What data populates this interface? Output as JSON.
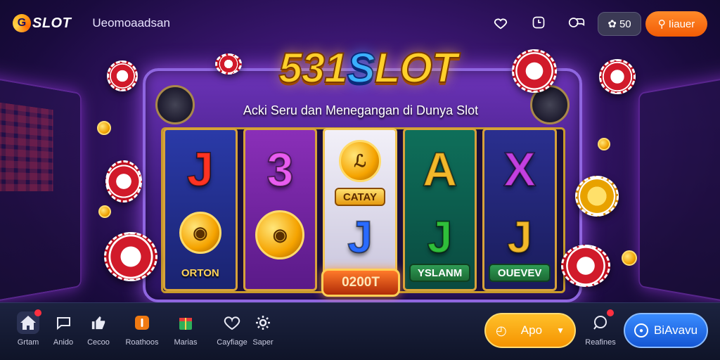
{
  "header": {
    "logo_text": "SLOT",
    "logo_mark": "G",
    "site_name": "Ueomoaadsan",
    "icons": [
      "heart-icon",
      "clock-icon",
      "chat-icon"
    ],
    "coin_value": "50",
    "search_label": "Iiauer"
  },
  "hero": {
    "title_part1": "531",
    "title_part2": "S",
    "title_part3": "LOT",
    "subtitle": "Acki Seru dan Menegangan di Dunya Slot"
  },
  "reels": [
    {
      "symbol": "J",
      "color": "#ff3322",
      "label": "ORTON"
    },
    {
      "symbol": "3",
      "color": "#e85cf0",
      "label": ""
    },
    {
      "symbol": "J",
      "color": "#2a6bff",
      "label": "CATAY"
    },
    {
      "symbol": "A",
      "color": "#f2b82a",
      "label": "YSLANM"
    },
    {
      "symbol": "X",
      "color": "#c23fe0",
      "label": "OUEVEV"
    }
  ],
  "reels_second": [
    "",
    "",
    "J",
    "J",
    "J"
  ],
  "reel_colors_second": [
    "",
    "",
    "#2a6bff",
    "#2fbf3a",
    "#f2b82a"
  ],
  "win_label": "0200T",
  "bottom_nav": [
    {
      "label": "Grtam",
      "icon": "home-icon",
      "active": true,
      "badge": true
    },
    {
      "label": "Anido",
      "icon": "chat-icon"
    },
    {
      "label": "Cecoo",
      "icon": "thumbs-up-icon"
    },
    {
      "label": "Roathoos",
      "icon": "info-icon"
    },
    {
      "label": "Marias",
      "icon": "gift-icon"
    },
    {
      "label": "Cayfiage",
      "icon": "heart-icon"
    },
    {
      "label": "Saper",
      "icon": "gear-icon"
    }
  ],
  "actions": {
    "app_label": "Apo",
    "notifications_label": "Reafines",
    "register_label": "BiAvavu"
  },
  "colors": {
    "accent_orange": "#f59300",
    "accent_blue": "#1456d4",
    "background": "#3a1670"
  }
}
